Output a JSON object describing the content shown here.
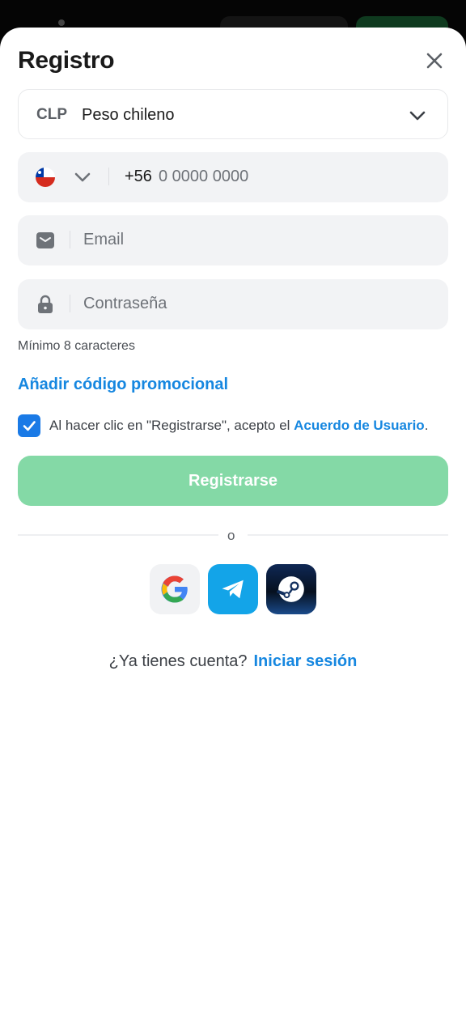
{
  "header": {
    "title": "Registro"
  },
  "currency": {
    "code": "CLP",
    "name": "Peso chileno"
  },
  "phone": {
    "country": "Chile",
    "prefix": "+56",
    "placeholder": "0 0000 0000"
  },
  "email": {
    "placeholder": "Email"
  },
  "password": {
    "placeholder": "Contraseña",
    "hint": "Mínimo 8 caracteres"
  },
  "promo": {
    "label": "Añadir código promocional"
  },
  "consent": {
    "checked": true,
    "text": "Al hacer clic en \"Registrarse\", acepto el ",
    "link": "Acuerdo de Usuario",
    "suffix": "."
  },
  "submit": {
    "label": "Registrarse"
  },
  "divider": {
    "label": "o"
  },
  "social": [
    {
      "name": "Google",
      "icon": "google-icon"
    },
    {
      "name": "Telegram",
      "icon": "telegram-icon"
    },
    {
      "name": "Steam",
      "icon": "steam-icon"
    }
  ],
  "footer": {
    "question": "¿Ya tienes cuenta?",
    "link": "Iniciar sesión"
  },
  "colors": {
    "accent": "#1687e0",
    "button": "#84d9a6",
    "checkbox": "#1a7ae6",
    "field_bg": "#f2f3f5"
  }
}
